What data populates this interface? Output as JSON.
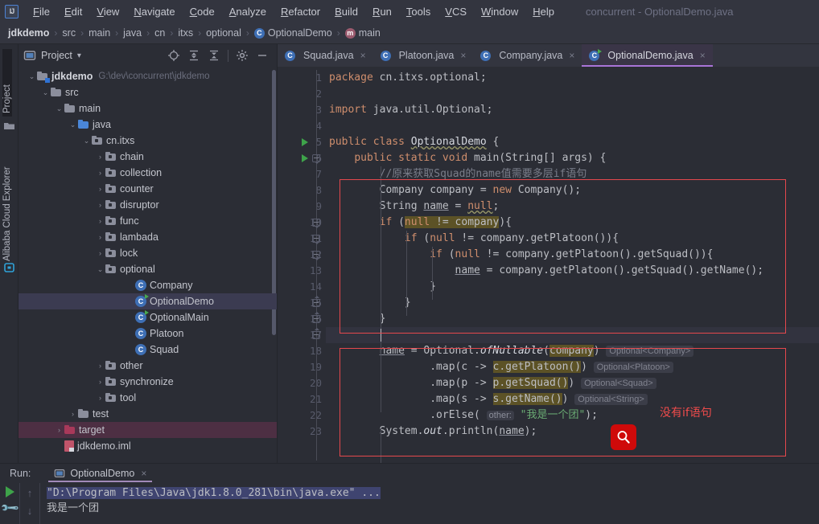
{
  "window": {
    "title": "concurrent - OptionalDemo.java"
  },
  "menu": {
    "items": [
      "File",
      "Edit",
      "View",
      "Navigate",
      "Code",
      "Analyze",
      "Refactor",
      "Build",
      "Run",
      "Tools",
      "VCS",
      "Window",
      "Help"
    ]
  },
  "breadcrumb": {
    "items": [
      {
        "label": "jdkdemo",
        "icon": "none",
        "bold": true
      },
      {
        "label": "src",
        "icon": "none",
        "bold": false
      },
      {
        "label": "main",
        "icon": "none",
        "bold": false
      },
      {
        "label": "java",
        "icon": "none",
        "bold": false
      },
      {
        "label": "cn",
        "icon": "none",
        "bold": false
      },
      {
        "label": "itxs",
        "icon": "none",
        "bold": false
      },
      {
        "label": "optional",
        "icon": "none",
        "bold": false
      },
      {
        "label": "OptionalDemo",
        "icon": "class-icon",
        "bold": false
      },
      {
        "label": "main",
        "icon": "method-icon",
        "bold": false
      }
    ],
    "separator": "›"
  },
  "left_strip": {
    "tabs": [
      {
        "label": "Project",
        "icon": "folder-icon",
        "selected": true
      },
      {
        "label": "Alibaba Cloud Explorer",
        "icon": "cloud-icon",
        "selected": false
      }
    ]
  },
  "project_panel": {
    "title": "Project",
    "dropdown_caret": "▾",
    "toolbar_icons": [
      "locate-icon",
      "expand-all-icon",
      "collapse-all-icon",
      "gear-icon",
      "minimize-icon"
    ],
    "tree": [
      {
        "indent": 0,
        "chev": "⌄",
        "icon": "module-icon",
        "label": "jdkdemo",
        "path": "G:\\dev\\concurrent\\jdkdemo",
        "bold": true,
        "state": "none"
      },
      {
        "indent": 1,
        "chev": "⌄",
        "icon": "folder-icon",
        "label": "src",
        "path": "",
        "bold": false,
        "state": "none"
      },
      {
        "indent": 2,
        "chev": "⌄",
        "icon": "folder-icon",
        "label": "main",
        "path": "",
        "bold": false,
        "state": "none"
      },
      {
        "indent": 3,
        "chev": "⌄",
        "icon": "folder-blue-icon",
        "label": "java",
        "path": "",
        "bold": false,
        "state": "none"
      },
      {
        "indent": 4,
        "chev": "⌄",
        "icon": "package-icon",
        "label": "cn.itxs",
        "path": "",
        "bold": false,
        "state": "none"
      },
      {
        "indent": 5,
        "chev": "›",
        "icon": "package-icon",
        "label": "chain",
        "path": "",
        "bold": false,
        "state": "none"
      },
      {
        "indent": 5,
        "chev": "›",
        "icon": "package-icon",
        "label": "collection",
        "path": "",
        "bold": false,
        "state": "none"
      },
      {
        "indent": 5,
        "chev": "›",
        "icon": "package-icon",
        "label": "counter",
        "path": "",
        "bold": false,
        "state": "none"
      },
      {
        "indent": 5,
        "chev": "›",
        "icon": "package-icon",
        "label": "disruptor",
        "path": "",
        "bold": false,
        "state": "none"
      },
      {
        "indent": 5,
        "chev": "›",
        "icon": "package-icon",
        "label": "func",
        "path": "",
        "bold": false,
        "state": "none"
      },
      {
        "indent": 5,
        "chev": "›",
        "icon": "package-icon",
        "label": "lambada",
        "path": "",
        "bold": false,
        "state": "none"
      },
      {
        "indent": 5,
        "chev": "›",
        "icon": "package-icon",
        "label": "lock",
        "path": "",
        "bold": false,
        "state": "none"
      },
      {
        "indent": 5,
        "chev": "⌄",
        "icon": "package-icon",
        "label": "optional",
        "path": "",
        "bold": false,
        "state": "none"
      },
      {
        "indent": 6,
        "chev": "",
        "icon": "class-icon",
        "label": "Company",
        "path": "",
        "bold": false,
        "state": "none"
      },
      {
        "indent": 6,
        "chev": "",
        "icon": "runnable-class-icon",
        "label": "OptionalDemo",
        "path": "",
        "bold": false,
        "state": "selected"
      },
      {
        "indent": 6,
        "chev": "",
        "icon": "runnable-class-icon",
        "label": "OptionalMain",
        "path": "",
        "bold": false,
        "state": "none"
      },
      {
        "indent": 6,
        "chev": "",
        "icon": "class-icon",
        "label": "Platoon",
        "path": "",
        "bold": false,
        "state": "none"
      },
      {
        "indent": 6,
        "chev": "",
        "icon": "class-icon",
        "label": "Squad",
        "path": "",
        "bold": false,
        "state": "none"
      },
      {
        "indent": 5,
        "chev": "›",
        "icon": "package-icon",
        "label": "other",
        "path": "",
        "bold": false,
        "state": "none"
      },
      {
        "indent": 5,
        "chev": "›",
        "icon": "package-icon",
        "label": "synchronize",
        "path": "",
        "bold": false,
        "state": "none"
      },
      {
        "indent": 5,
        "chev": "›",
        "icon": "package-icon",
        "label": "tool",
        "path": "",
        "bold": false,
        "state": "none"
      },
      {
        "indent": 3,
        "chev": "›",
        "icon": "folder-icon",
        "label": "test",
        "path": "",
        "bold": false,
        "state": "none"
      },
      {
        "indent": 1,
        "chev": "›",
        "icon": "folder-red-icon",
        "label": "target",
        "path": "",
        "bold": false,
        "state": "target"
      },
      {
        "indent": 1,
        "chev": "",
        "icon": "iml-file-icon",
        "label": "jdkdemo.iml",
        "path": "",
        "bold": false,
        "state": "none"
      }
    ]
  },
  "editor": {
    "tabs": [
      {
        "label": "Squad.java",
        "icon": "class-icon",
        "active": false,
        "close": "×"
      },
      {
        "label": "Platoon.java",
        "icon": "class-icon",
        "active": false,
        "close": "×"
      },
      {
        "label": "Company.java",
        "icon": "class-icon",
        "active": false,
        "close": "×"
      },
      {
        "label": "OptionalDemo.java",
        "icon": "runnable-class-icon",
        "active": true,
        "close": "×"
      }
    ],
    "line_numbers": [
      "1",
      "2",
      "3",
      "4",
      "5",
      "6",
      "7",
      "8",
      "9",
      "10",
      "11",
      "12",
      "13",
      "14",
      "15",
      "16",
      "17",
      "18",
      "19",
      "20",
      "21",
      "22",
      "23"
    ],
    "code_lines": [
      {
        "n": 1,
        "text": "package cn.itxs.optional;"
      },
      {
        "n": 2,
        "text": ""
      },
      {
        "n": 3,
        "text": "import java.util.Optional;"
      },
      {
        "n": 4,
        "text": ""
      },
      {
        "n": 5,
        "text": "public class OptionalDemo {"
      },
      {
        "n": 6,
        "text": "    public static void main(String[] args) {"
      },
      {
        "n": 7,
        "text": "        //原来获取Squad的name值需要多层if语句"
      },
      {
        "n": 8,
        "text": "        Company company = new Company();"
      },
      {
        "n": 9,
        "text": "        String name = null;"
      },
      {
        "n": 10,
        "text": "        if (null != company){"
      },
      {
        "n": 11,
        "text": "            if (null != company.getPlatoon()){"
      },
      {
        "n": 12,
        "text": "                if (null != company.getPlatoon().getSquad()){"
      },
      {
        "n": 13,
        "text": "                    name = company.getPlatoon().getSquad().getName();"
      },
      {
        "n": 14,
        "text": "                }"
      },
      {
        "n": 15,
        "text": "            }"
      },
      {
        "n": 16,
        "text": "        }"
      },
      {
        "n": 17,
        "text": ""
      },
      {
        "n": 18,
        "text": "        name = Optional.ofNullable(company)"
      },
      {
        "n": 19,
        "text": "                .map(c -> c.getPlatoon())"
      },
      {
        "n": 20,
        "text": "                .map(p -> p.getSquad())"
      },
      {
        "n": 21,
        "text": "                .map(s -> s.getName())"
      },
      {
        "n": 22,
        "text": "                .orElse( other: \"我是一个团\");"
      },
      {
        "n": 23,
        "text": "        System.out.println(name);"
      }
    ],
    "inlay_hints": [
      {
        "line": 18,
        "text": "Optional<Company>"
      },
      {
        "line": 19,
        "text": "Optional<Platoon>"
      },
      {
        "line": 20,
        "text": "Optional<Squad>"
      },
      {
        "line": 21,
        "text": "Optional<String>"
      },
      {
        "line": 22,
        "text": "other:"
      }
    ],
    "annotations": [
      {
        "type": "red-text",
        "text": "没有if语句"
      },
      {
        "type": "magnifier-icon",
        "glyph": "⌕"
      }
    ]
  },
  "run_panel": {
    "label": "Run:",
    "tab_label": "OptionalDemo",
    "tab_close": "×",
    "side_icons": [
      "rerun-icon",
      "settings-icon",
      "scroll-up-icon",
      "scroll-down-icon"
    ],
    "output": [
      {
        "text": "\"D:\\Program Files\\Java\\jdk1.8.0_281\\bin\\java.exe\" ...",
        "selected": true
      },
      {
        "text": "我是一个团",
        "selected": false
      }
    ]
  },
  "colors": {
    "accent_purple": "#a974d8",
    "annotation_red": "#ef4b4b",
    "magnifier_red": "#cf0a0a",
    "keyword_orange": "#cf8e6d",
    "string_green": "#6aab73",
    "selection_blue": "#3f4470"
  }
}
